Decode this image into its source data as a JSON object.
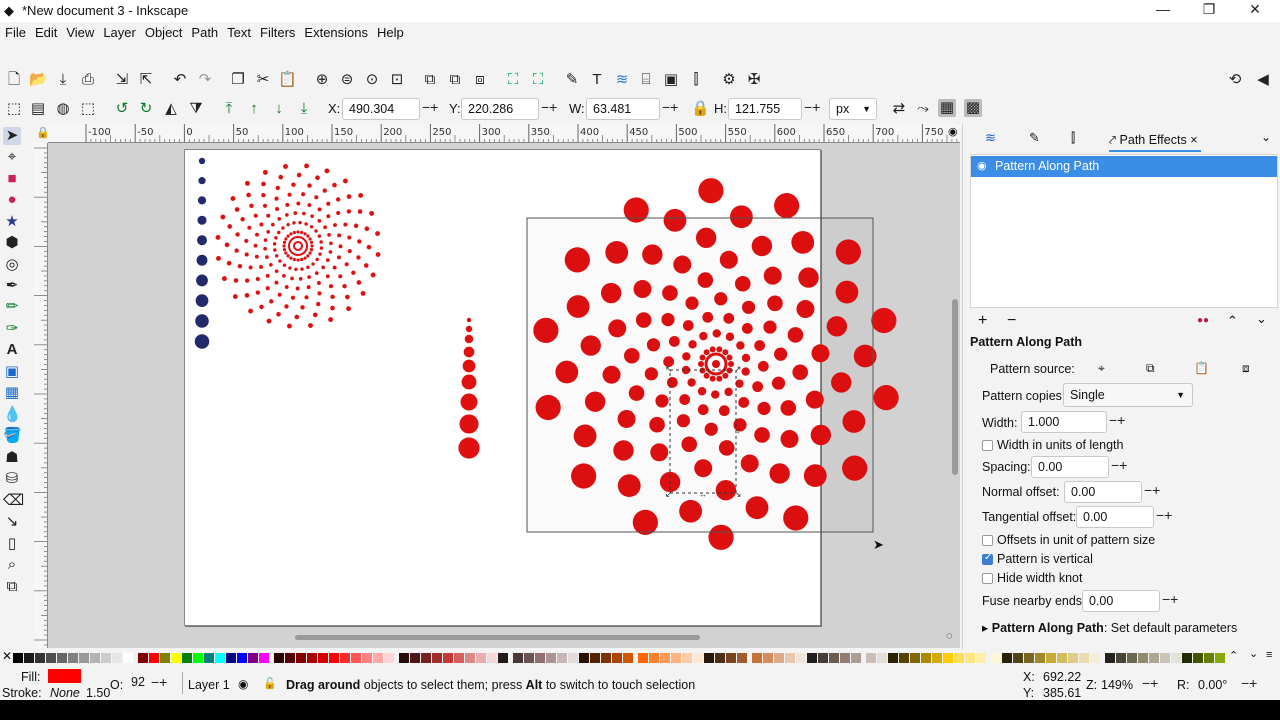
{
  "window": {
    "title": "*New document 3 - Inkscape",
    "minimize": "—",
    "restore": "❐",
    "close": "✕"
  },
  "menu": [
    "File",
    "Edit",
    "View",
    "Layer",
    "Object",
    "Path",
    "Text",
    "Filters",
    "Extensions",
    "Help"
  ],
  "toolcontrols": {
    "x_label": "X:",
    "x_value": "490.304",
    "y_label": "Y:",
    "y_value": "220.286",
    "w_label": "W:",
    "w_value": "63.481",
    "h_label": "H:",
    "h_value": "121.755",
    "unit": "px"
  },
  "ruler_labels": [
    "-100",
    "-50",
    "0",
    "50",
    "100",
    "150",
    "200",
    "250",
    "300",
    "350",
    "400",
    "450",
    "500",
    "550",
    "600",
    "650",
    "700",
    "750"
  ],
  "dock": {
    "tab_active": "Path Effects",
    "effect_item": "Pattern Along Path",
    "section_title": "Pattern Along Path",
    "pattern_source_label": "Pattern source:",
    "pattern_copies_label": "Pattern copies:",
    "pattern_copies_value": "Single",
    "width_label": "Width:",
    "width_value": "1.000",
    "width_units_label": "Width in units of length",
    "spacing_label": "Spacing:",
    "spacing_value": "0.00",
    "normal_offset_label": "Normal offset:",
    "normal_offset_value": "0.00",
    "tangential_offset_label": "Tangential offset:",
    "tangential_offset_value": "0.00",
    "offsets_units_label": "Offsets in unit of pattern size",
    "pattern_vertical_label": "Pattern is vertical",
    "hide_width_knot_label": "Hide width knot",
    "fuse_label": "Fuse nearby ends:",
    "fuse_value": "0.00",
    "defaults_bold": "Pattern Along Path",
    "defaults_text": ": Set default parameters"
  },
  "status": {
    "fill_label": "Fill:",
    "stroke_label": "Stroke:",
    "stroke_value": "None",
    "stroke_width": "1.50",
    "opacity_label": "O:",
    "opacity_value": "92",
    "layer": "Layer 1",
    "message_bold1": "Drag around",
    "message_mid": " objects to select them; press ",
    "message_bold2": "Alt",
    "message_end": " to switch to touch selection",
    "x_label": "X:",
    "x_value": "692.22",
    "y_label": "Y:",
    "y_value": "385.61",
    "zoom_label": "Z:",
    "zoom_value": "149%",
    "rotate_label": "R:",
    "rotate_value": "0.00°"
  },
  "colors": {
    "accent": "#3a8ee6",
    "fill": "#ff0000",
    "dots_red": "#e01010",
    "dots_navy": "#232a6b"
  },
  "palette": [
    "#000000",
    "#1a1a1a",
    "#333333",
    "#4d4d4d",
    "#666666",
    "#808080",
    "#999999",
    "#b3b3b3",
    "#cccccc",
    "#e6e6e6",
    "#ffffff",
    "#800000",
    "#ff0000",
    "#808000",
    "#ffff00",
    "#008000",
    "#00ff00",
    "#008080",
    "#00ffff",
    "#000080",
    "#0000ff",
    "#800080",
    "#ff00ff",
    "#2b0000",
    "#550000",
    "#800000",
    "#aa0000",
    "#d40000",
    "#ff0000",
    "#ff2a2a",
    "#ff5555",
    "#ff8080",
    "#ffaaaa",
    "#ffd5d5",
    "#280b0b",
    "#501616",
    "#782121",
    "#a02c2c",
    "#c83737",
    "#d35f5f",
    "#de8787",
    "#e9afaf",
    "#f4d7d7",
    "#241c1c",
    "#483737",
    "#6c5353",
    "#916f6f",
    "#ac9393",
    "#c8b7b7",
    "#e3dbdb",
    "#2b1100",
    "#552200",
    "#803300",
    "#aa4400",
    "#d45500",
    "#ff6600",
    "#ff7f2a",
    "#ff9955",
    "#ffb380",
    "#ffccaa",
    "#ffe6d5",
    "#28170b",
    "#502d16",
    "#784421",
    "#a05a2c",
    "#c87137",
    "#d38d5f",
    "#deaa87",
    "#e9c6af",
    "#f4e3d7",
    "#241f1c",
    "#483e37",
    "#6c5d53",
    "#917c6f",
    "#ac9d93",
    "#c8beb7",
    "#e3dedb",
    "#2b2200",
    "#554400",
    "#806600",
    "#aa8800",
    "#d4aa00",
    "#ffcc00",
    "#ffdd55",
    "#ffe680",
    "#ffeeaa",
    "#fff6d5",
    "#28220b",
    "#504416",
    "#786721",
    "#a0892c",
    "#c8ab37",
    "#d3bc5f",
    "#decd87",
    "#e9ddaf",
    "#f4eed7",
    "#24221c",
    "#484537",
    "#6c6753",
    "#918a6f",
    "#aca793",
    "#c8c4b7",
    "#e3e2db",
    "#222b00",
    "#445500",
    "#668000",
    "#88aa00",
    "#aad400",
    "#ccff00",
    "#ddff55",
    "#eeffaa"
  ]
}
